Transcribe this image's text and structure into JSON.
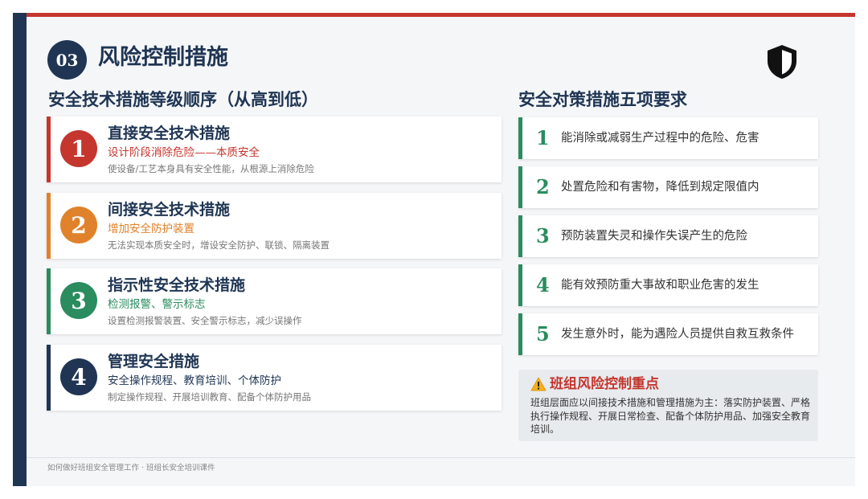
{
  "header": {
    "number": "03",
    "title": "风险控制措施",
    "icon": "shield-icon"
  },
  "left": {
    "title": "安全技术措施等级顺序（从高到低）",
    "items": [
      {
        "num": "1",
        "title": "直接安全技术措施",
        "subtitle": "设计阶段消除危险——本质安全",
        "desc": "使设备/工艺本身具有安全性能，从根源上消除危险",
        "color": "#c4362e"
      },
      {
        "num": "2",
        "title": "间接安全技术措施",
        "subtitle": "增加安全防护装置",
        "desc": "无法实现本质安全时，增设安全防护、联锁、隔离装置",
        "color": "#e0822b"
      },
      {
        "num": "3",
        "title": "指示性安全技术措施",
        "subtitle": "检测报警、警示标志",
        "desc": "设置检测报警装置、安全警示标志，减少误操作",
        "color": "#2a8c5f"
      },
      {
        "num": "4",
        "title": "管理安全措施",
        "subtitle": "安全操作规程、教育培训、个体防护",
        "desc": "制定操作规程、开展培训教育、配备个体防护用品",
        "color": "#1f3553"
      }
    ]
  },
  "right": {
    "title": "安全对策措施五项要求",
    "items": [
      {
        "num": "1",
        "text": "能消除或减弱生产过程中的危险、危害"
      },
      {
        "num": "2",
        "text": "处置危险和有害物，降低到规定限值内"
      },
      {
        "num": "3",
        "text": "预防装置失灵和操作失误产生的危险"
      },
      {
        "num": "4",
        "text": "能有效预防重大事故和职业危害的发生"
      },
      {
        "num": "5",
        "text": "发生意外时，能为遇险人员提供自救互救条件"
      }
    ],
    "accent": "#2a8c5f"
  },
  "focus": {
    "icon": "warning-icon",
    "title": "班组风险控制重点",
    "text": "班组层面应以间接技术措施和管理措施为主：落实防护装置、严格执行操作规程、开展日常检查、配备个体防护用品、加强安全教育培训。"
  },
  "footer": {
    "text": "如何做好班组安全管理工作 · 班组长安全培训课件"
  },
  "colors": {
    "navy": "#1f3553",
    "red": "#c4362e",
    "orange": "#e0822b",
    "green": "#2a8c5f"
  }
}
